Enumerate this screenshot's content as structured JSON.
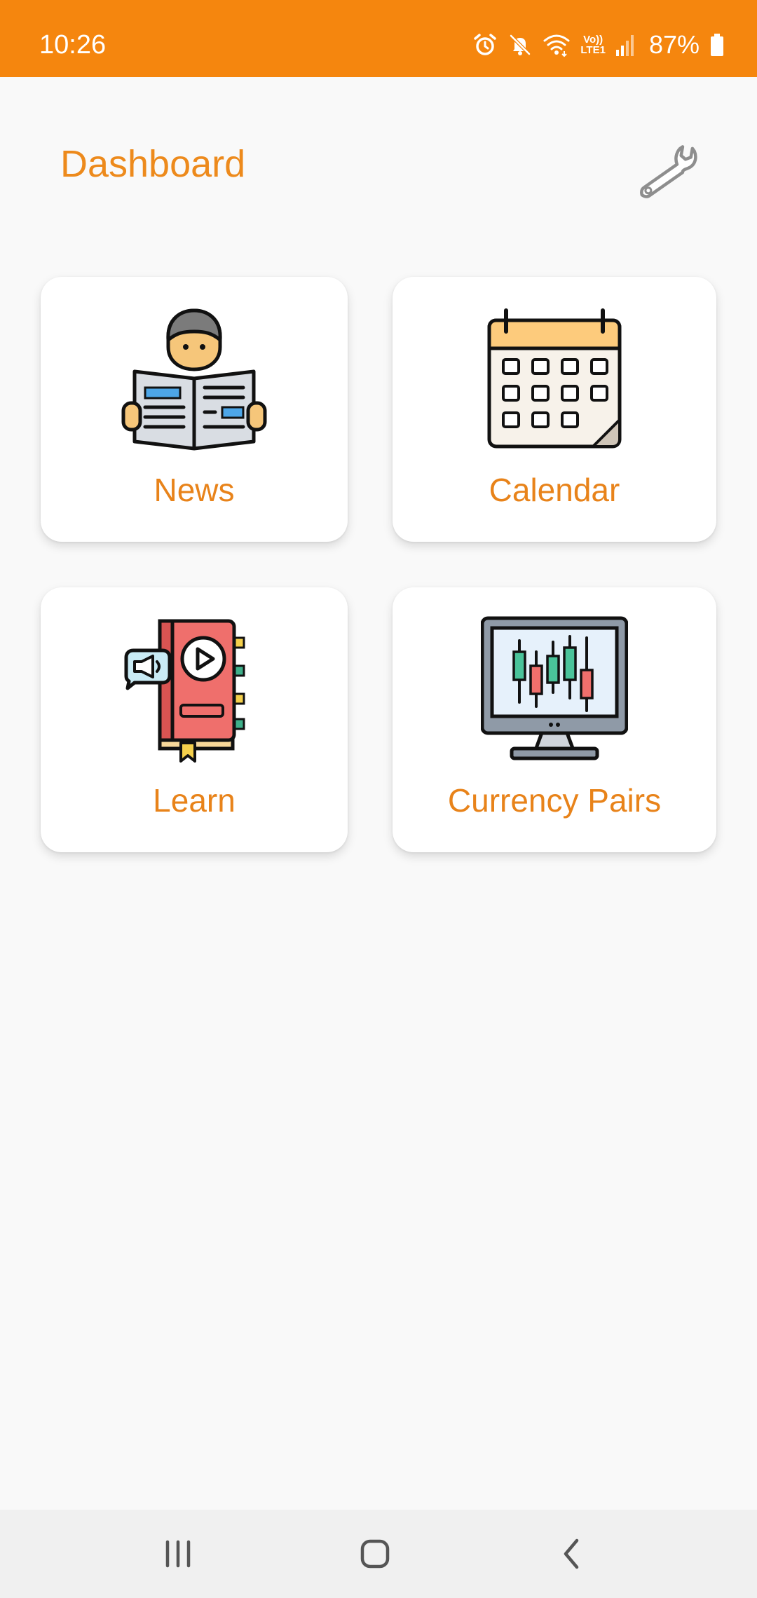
{
  "status_bar": {
    "time": "10:26",
    "network_label_top": "Vo))",
    "network_label_bottom": "LTE1",
    "battery": "87%",
    "icons": [
      "alarm-icon",
      "mute-icon",
      "wifi-icon",
      "signal-icon",
      "battery-icon"
    ]
  },
  "header": {
    "title": "Dashboard",
    "settings_icon": "wrench-icon"
  },
  "cards": [
    {
      "label": "News",
      "icon": "newspaper-reader-icon"
    },
    {
      "label": "Calendar",
      "icon": "calendar-icon"
    },
    {
      "label": "Learn",
      "icon": "video-book-icon"
    },
    {
      "label": "Currency Pairs",
      "icon": "candlestick-monitor-icon"
    }
  ],
  "nav_bar": {
    "buttons": [
      "recent-apps-icon",
      "home-icon",
      "back-icon"
    ]
  },
  "colors": {
    "accent": "#f5860e",
    "label": "#e8831a",
    "background": "#f9f9f9",
    "card": "#ffffff"
  }
}
